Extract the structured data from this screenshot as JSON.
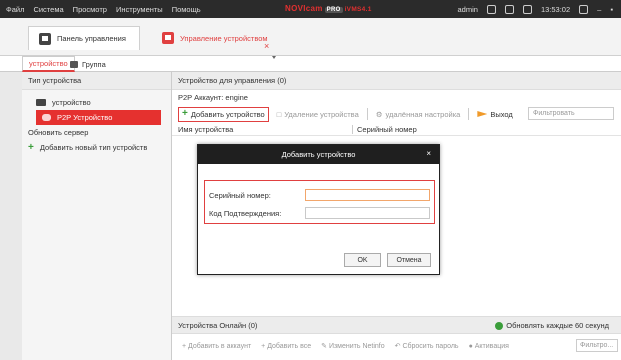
{
  "topbar": {
    "menu": [
      "Файл",
      "Система",
      "Просмотр",
      "Инструменты",
      "Помощь"
    ],
    "brand": "NOVIcam",
    "brand_badge": "PRO",
    "brand_suffix": "iVMS4.1",
    "user": "admin",
    "time": "13:53:02"
  },
  "main_tabs": {
    "control_panel": "Панель управления",
    "device_mgmt": "Управление устройством"
  },
  "sub_tabs": {
    "devices": "устройство",
    "group": "Группа"
  },
  "left_panel": {
    "header": "Тип устройства",
    "items": [
      {
        "label": "устройство"
      },
      {
        "label": "P2P Устройство"
      },
      {
        "label": "Обновить сервер"
      },
      {
        "label": "Добавить новый тип устройств"
      }
    ]
  },
  "main_panel": {
    "header": "Устройство для управления (0)",
    "account": "P2P Аккаунт:  engine",
    "toolbar": {
      "add": "Добавить устройство",
      "delete": "Удаление устройства",
      "remote": "удалённая настройка",
      "exit": "Выход",
      "filter_placeholder": "Фильтровать"
    },
    "columns": [
      "Имя устройства",
      "Серийный номер"
    ],
    "online_header": "Устройства Онлайн (0)",
    "refresh": "Обновлять каждые 60 секунд",
    "bottom_toolbar": [
      "Добавить в аккаунт",
      "Добавить все",
      "Изменить Netinfo",
      "Сбросить пароль",
      "Активация"
    ],
    "bottom_filter_placeholder": "Фильтро..."
  },
  "dialog": {
    "title": "Добавить устройство",
    "serial_label": "Серийный номер:",
    "code_label": "Код Подтверждения:",
    "ok": "OK",
    "cancel": "Отмена"
  },
  "colors": {
    "accent": "#e5312f",
    "dark": "#2b2b2b"
  }
}
